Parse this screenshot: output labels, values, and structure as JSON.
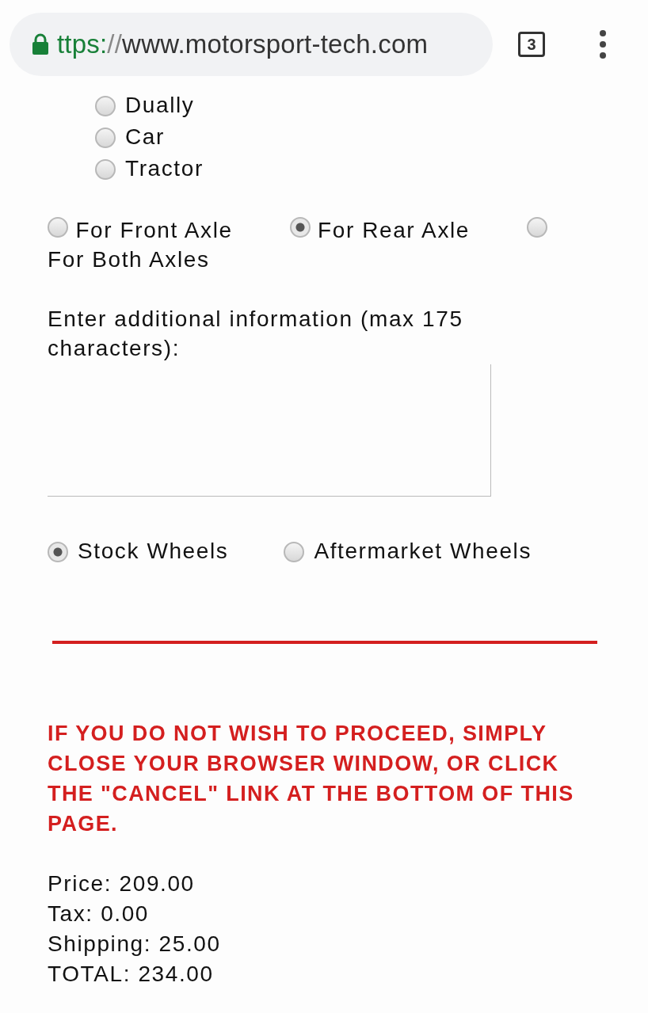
{
  "address_bar": {
    "scheme": "ttps:",
    "separator": "//",
    "host": "www.motorsport-tech.com",
    "secure": true
  },
  "tabs_count": "3",
  "vehicle_options": [
    {
      "label": "Dually",
      "selected": false
    },
    {
      "label": "Car",
      "selected": false
    },
    {
      "label": "Tractor",
      "selected": false
    }
  ],
  "axle_options": [
    {
      "label": "For Front Axle",
      "selected": false
    },
    {
      "label": "For Rear Axle",
      "selected": true
    },
    {
      "label": "For Both Axles",
      "selected": false
    }
  ],
  "additional_info": {
    "label": "Enter additional information (max 175 characters):"
  },
  "wheel_options": [
    {
      "label": "Stock Wheels",
      "selected": true
    },
    {
      "label": "Aftermarket Wheels",
      "selected": false
    }
  ],
  "warning": "IF YOU DO NOT WISH TO PROCEED, SIMPLY CLOSE YOUR BROWSER WINDOW, OR CLICK THE \"CANCEL\" LINK AT THE BOTTOM OF THIS PAGE.",
  "summary": [
    "Price: 209.00",
    "Tax: 0.00",
    "Shipping: 25.00",
    "TOTAL: 234.00"
  ]
}
